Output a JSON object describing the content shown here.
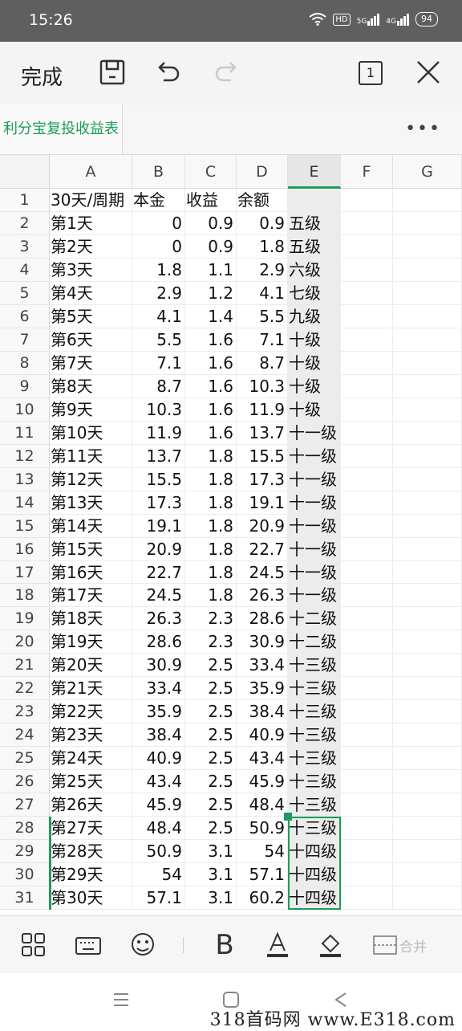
{
  "status": {
    "time": "15:26",
    "hd": "HD",
    "signal1": "5G",
    "signal2": "4G",
    "battery": "94"
  },
  "toolbar": {
    "done_label": "完成",
    "sheet_count": "1"
  },
  "document": {
    "title": "利分宝复投收益表",
    "more_label": "•••"
  },
  "columns": [
    "A",
    "B",
    "C",
    "D",
    "E",
    "F",
    "G"
  ],
  "rows": [
    [
      "30天/周期",
      "本金",
      "收益",
      "余额",
      ""
    ],
    [
      "第1天",
      "0",
      "0.9",
      "0.9",
      "五级"
    ],
    [
      "第2天",
      "0",
      "0.9",
      "1.8",
      "五级"
    ],
    [
      "第3天",
      "1.8",
      "1.1",
      "2.9",
      "六级"
    ],
    [
      "第4天",
      "2.9",
      "1.2",
      "4.1",
      "七级"
    ],
    [
      "第5天",
      "4.1",
      "1.4",
      "5.5",
      "九级"
    ],
    [
      "第6天",
      "5.5",
      "1.6",
      "7.1",
      "十级"
    ],
    [
      "第7天",
      "7.1",
      "1.6",
      "8.7",
      "十级"
    ],
    [
      "第8天",
      "8.7",
      "1.6",
      "10.3",
      "十级"
    ],
    [
      "第9天",
      "10.3",
      "1.6",
      "11.9",
      "十级"
    ],
    [
      "第10天",
      "11.9",
      "1.6",
      "13.7",
      "十一级"
    ],
    [
      "第11天",
      "13.7",
      "1.8",
      "15.5",
      "十一级"
    ],
    [
      "第12天",
      "15.5",
      "1.8",
      "17.3",
      "十一级"
    ],
    [
      "第13天",
      "17.3",
      "1.8",
      "19.1",
      "十一级"
    ],
    [
      "第14天",
      "19.1",
      "1.8",
      "20.9",
      "十一级"
    ],
    [
      "第15天",
      "20.9",
      "1.8",
      "22.7",
      "十一级"
    ],
    [
      "第16天",
      "22.7",
      "1.8",
      "24.5",
      "十一级"
    ],
    [
      "第17天",
      "24.5",
      "1.8",
      "26.3",
      "十一级"
    ],
    [
      "第18天",
      "26.3",
      "2.3",
      "28.6",
      "十二级"
    ],
    [
      "第19天",
      "28.6",
      "2.3",
      "30.9",
      "十二级"
    ],
    [
      "第20天",
      "30.9",
      "2.5",
      "33.4",
      "十三级"
    ],
    [
      "第21天",
      "33.4",
      "2.5",
      "35.9",
      "十三级"
    ],
    [
      "第22天",
      "35.9",
      "2.5",
      "38.4",
      "十三级"
    ],
    [
      "第23天",
      "38.4",
      "2.5",
      "40.9",
      "十三级"
    ],
    [
      "第24天",
      "40.9",
      "2.5",
      "43.4",
      "十三级"
    ],
    [
      "第25天",
      "43.4",
      "2.5",
      "45.9",
      "十三级"
    ],
    [
      "第26天",
      "45.9",
      "2.5",
      "48.4",
      "十三级"
    ],
    [
      "第27天",
      "48.4",
      "2.5",
      "50.9",
      "十三级"
    ],
    [
      "第28天",
      "50.9",
      "3.1",
      "54",
      "十四级"
    ],
    [
      "第29天",
      "54",
      "3.1",
      "57.1",
      "十四级"
    ],
    [
      "第30天",
      "57.1",
      "3.1",
      "60.2",
      "十四级"
    ]
  ],
  "bottombar": {
    "merge_label": "合并"
  },
  "watermark": "318首码网 www.E318.com",
  "colors": {
    "accent": "#1e9b5c",
    "statusbar": "#5f5f5f"
  }
}
